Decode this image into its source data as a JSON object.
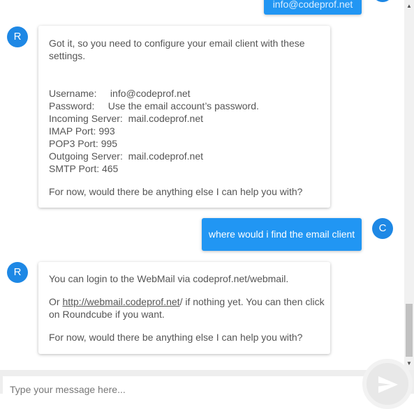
{
  "avatars": {
    "bot_initial": "R",
    "user_initial": "C"
  },
  "messages": {
    "prev_user_partial": "info@codeprof.net",
    "bot_settings": {
      "intro_line1": "Got it, so you need to configure your email client with these",
      "intro_line2": "settings.",
      "username": "Username:     info@codeprof.net",
      "password": "Password:     Use the email account’s password.",
      "incoming": "Incoming Server:  mail.codeprof.net",
      "imap": "IMAP Port: 993",
      "pop3": "POP3 Port: 995",
      "outgoing": "Outgoing Server:  mail.codeprof.net",
      "smtp": "SMTP Port: 465",
      "followup": "For now, would there be anything else I can help you with?"
    },
    "user_question": "where would i find the email client",
    "bot_webmail": {
      "line1": "You can login to the WebMail via codeprof.net/webmail.",
      "or_prefix": "Or ",
      "link_text": "http://webmail.codeprof.net",
      "or_suffix": "/ if nothing yet. You can then click",
      "line3": "on Roundcube if you want.",
      "followup": "For now, would there be anything else I can help you with?"
    }
  },
  "composer": {
    "placeholder": "Type your message here..."
  },
  "colors": {
    "accent": "#2196f3",
    "avatar": "#1e88e5"
  },
  "icons": {
    "send": "send-icon",
    "scroll_up": "scroll-up-arrow-icon",
    "scroll_down": "scroll-down-arrow-icon"
  }
}
